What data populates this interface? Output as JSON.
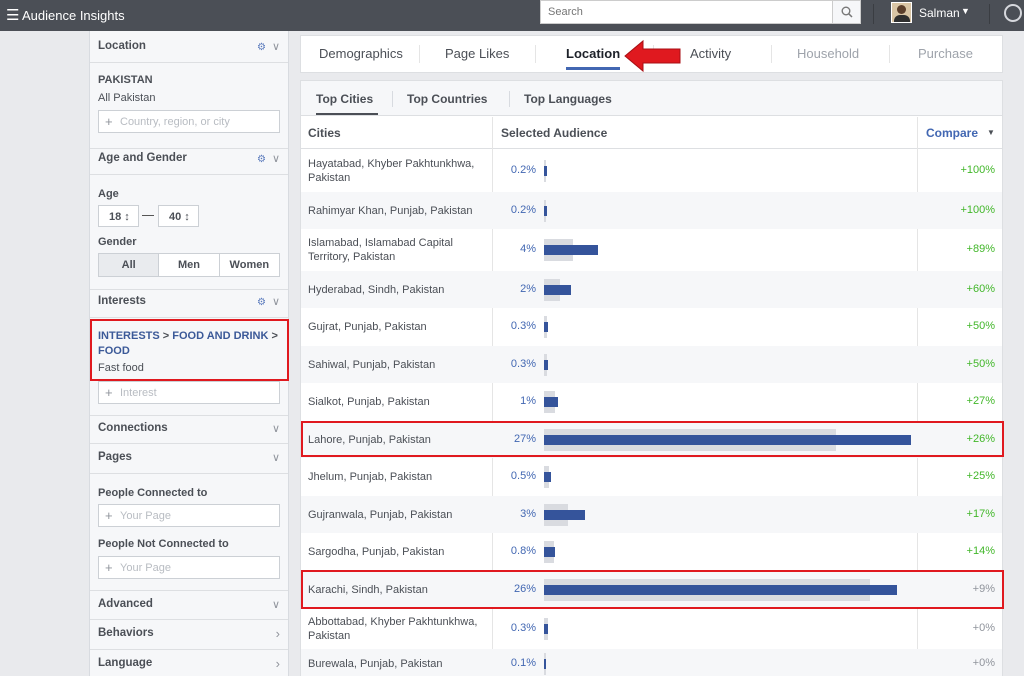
{
  "topbar": {
    "app_title": "Audience Insights",
    "search_placeholder": "Search",
    "user_name": "Salman"
  },
  "sidebar": {
    "location": {
      "title": "Location",
      "country": "PAKISTAN",
      "value": "All Pakistan",
      "placeholder": "Country, region, or city"
    },
    "age_gender": {
      "title": "Age and Gender",
      "age_label": "Age",
      "age_min": "18",
      "age_max": "40",
      "gender_label": "Gender",
      "genders": [
        "All",
        "Men",
        "Women"
      ],
      "gender_selected": "All"
    },
    "interests": {
      "title": "Interests",
      "path_1": "INTERESTS",
      "sep": " > ",
      "path_2": "FOOD AND DRINK",
      "path_3": "FOOD",
      "value": "Fast food",
      "placeholder": "Interest"
    },
    "connections": {
      "title": "Connections"
    },
    "pages": {
      "title": "Pages",
      "connected_label": "People Connected to",
      "connected_placeholder": "Your Page",
      "not_connected_label": "People Not Connected to",
      "not_connected_placeholder": "Your Page"
    },
    "advanced": {
      "title": "Advanced"
    },
    "behaviors": {
      "title": "Behaviors"
    },
    "language": {
      "title": "Language"
    }
  },
  "tabs": [
    "Demographics",
    "Page Likes",
    "Location",
    "Activity",
    "Household",
    "Purchase"
  ],
  "active_tab": "Location",
  "subtabs": [
    "Top Cities",
    "Top Countries",
    "Top Languages"
  ],
  "active_subtab": "Top Cities",
  "table": {
    "col_cities": "Cities",
    "col_audience": "Selected Audience",
    "col_compare": "Compare",
    "rows": [
      {
        "city": "Hayatabad, Khyber Pakhtunkhwa, Pakistan",
        "pct": "0.2%",
        "value": 0.2,
        "compare": "+100%",
        "baseline": 0.1
      },
      {
        "city": "Rahimyar Khan, Punjab, Pakistan",
        "pct": "0.2%",
        "value": 0.2,
        "compare": "+100%",
        "baseline": 0.1
      },
      {
        "city": "Islamabad, Islamabad Capital Territory, Pakistan",
        "pct": "4%",
        "value": 4,
        "compare": "+89%",
        "baseline": 2.1
      },
      {
        "city": "Hyderabad, Sindh, Pakistan",
        "pct": "2%",
        "value": 2,
        "compare": "+60%",
        "baseline": 1.2
      },
      {
        "city": "Gujrat, Punjab, Pakistan",
        "pct": "0.3%",
        "value": 0.3,
        "compare": "+50%",
        "baseline": 0.2
      },
      {
        "city": "Sahiwal, Punjab, Pakistan",
        "pct": "0.3%",
        "value": 0.3,
        "compare": "+50%",
        "baseline": 0.2
      },
      {
        "city": "Sialkot, Punjab, Pakistan",
        "pct": "1%",
        "value": 1,
        "compare": "+27%",
        "baseline": 0.8
      },
      {
        "city": "Lahore, Punjab, Pakistan",
        "pct": "27%",
        "value": 27,
        "compare": "+26%",
        "baseline": 21.5
      },
      {
        "city": "Jhelum, Punjab, Pakistan",
        "pct": "0.5%",
        "value": 0.5,
        "compare": "+25%",
        "baseline": 0.4
      },
      {
        "city": "Gujranwala, Punjab, Pakistan",
        "pct": "3%",
        "value": 3,
        "compare": "+17%",
        "baseline": 1.8
      },
      {
        "city": "Sargodha, Punjab, Pakistan",
        "pct": "0.8%",
        "value": 0.8,
        "compare": "+14%",
        "baseline": 0.7
      },
      {
        "city": "Karachi, Sindh, Pakistan",
        "pct": "26%",
        "value": 26,
        "compare": "+9%",
        "baseline": 24
      },
      {
        "city": "Abbottabad, Khyber Pakhtunkhwa, Pakistan",
        "pct": "0.3%",
        "value": 0.3,
        "compare": "+0%",
        "baseline": 0.3
      },
      {
        "city": "Burewala, Punjab, Pakistan",
        "pct": "0.1%",
        "value": 0.1,
        "compare": "+0%",
        "baseline": 0.1
      }
    ]
  }
}
